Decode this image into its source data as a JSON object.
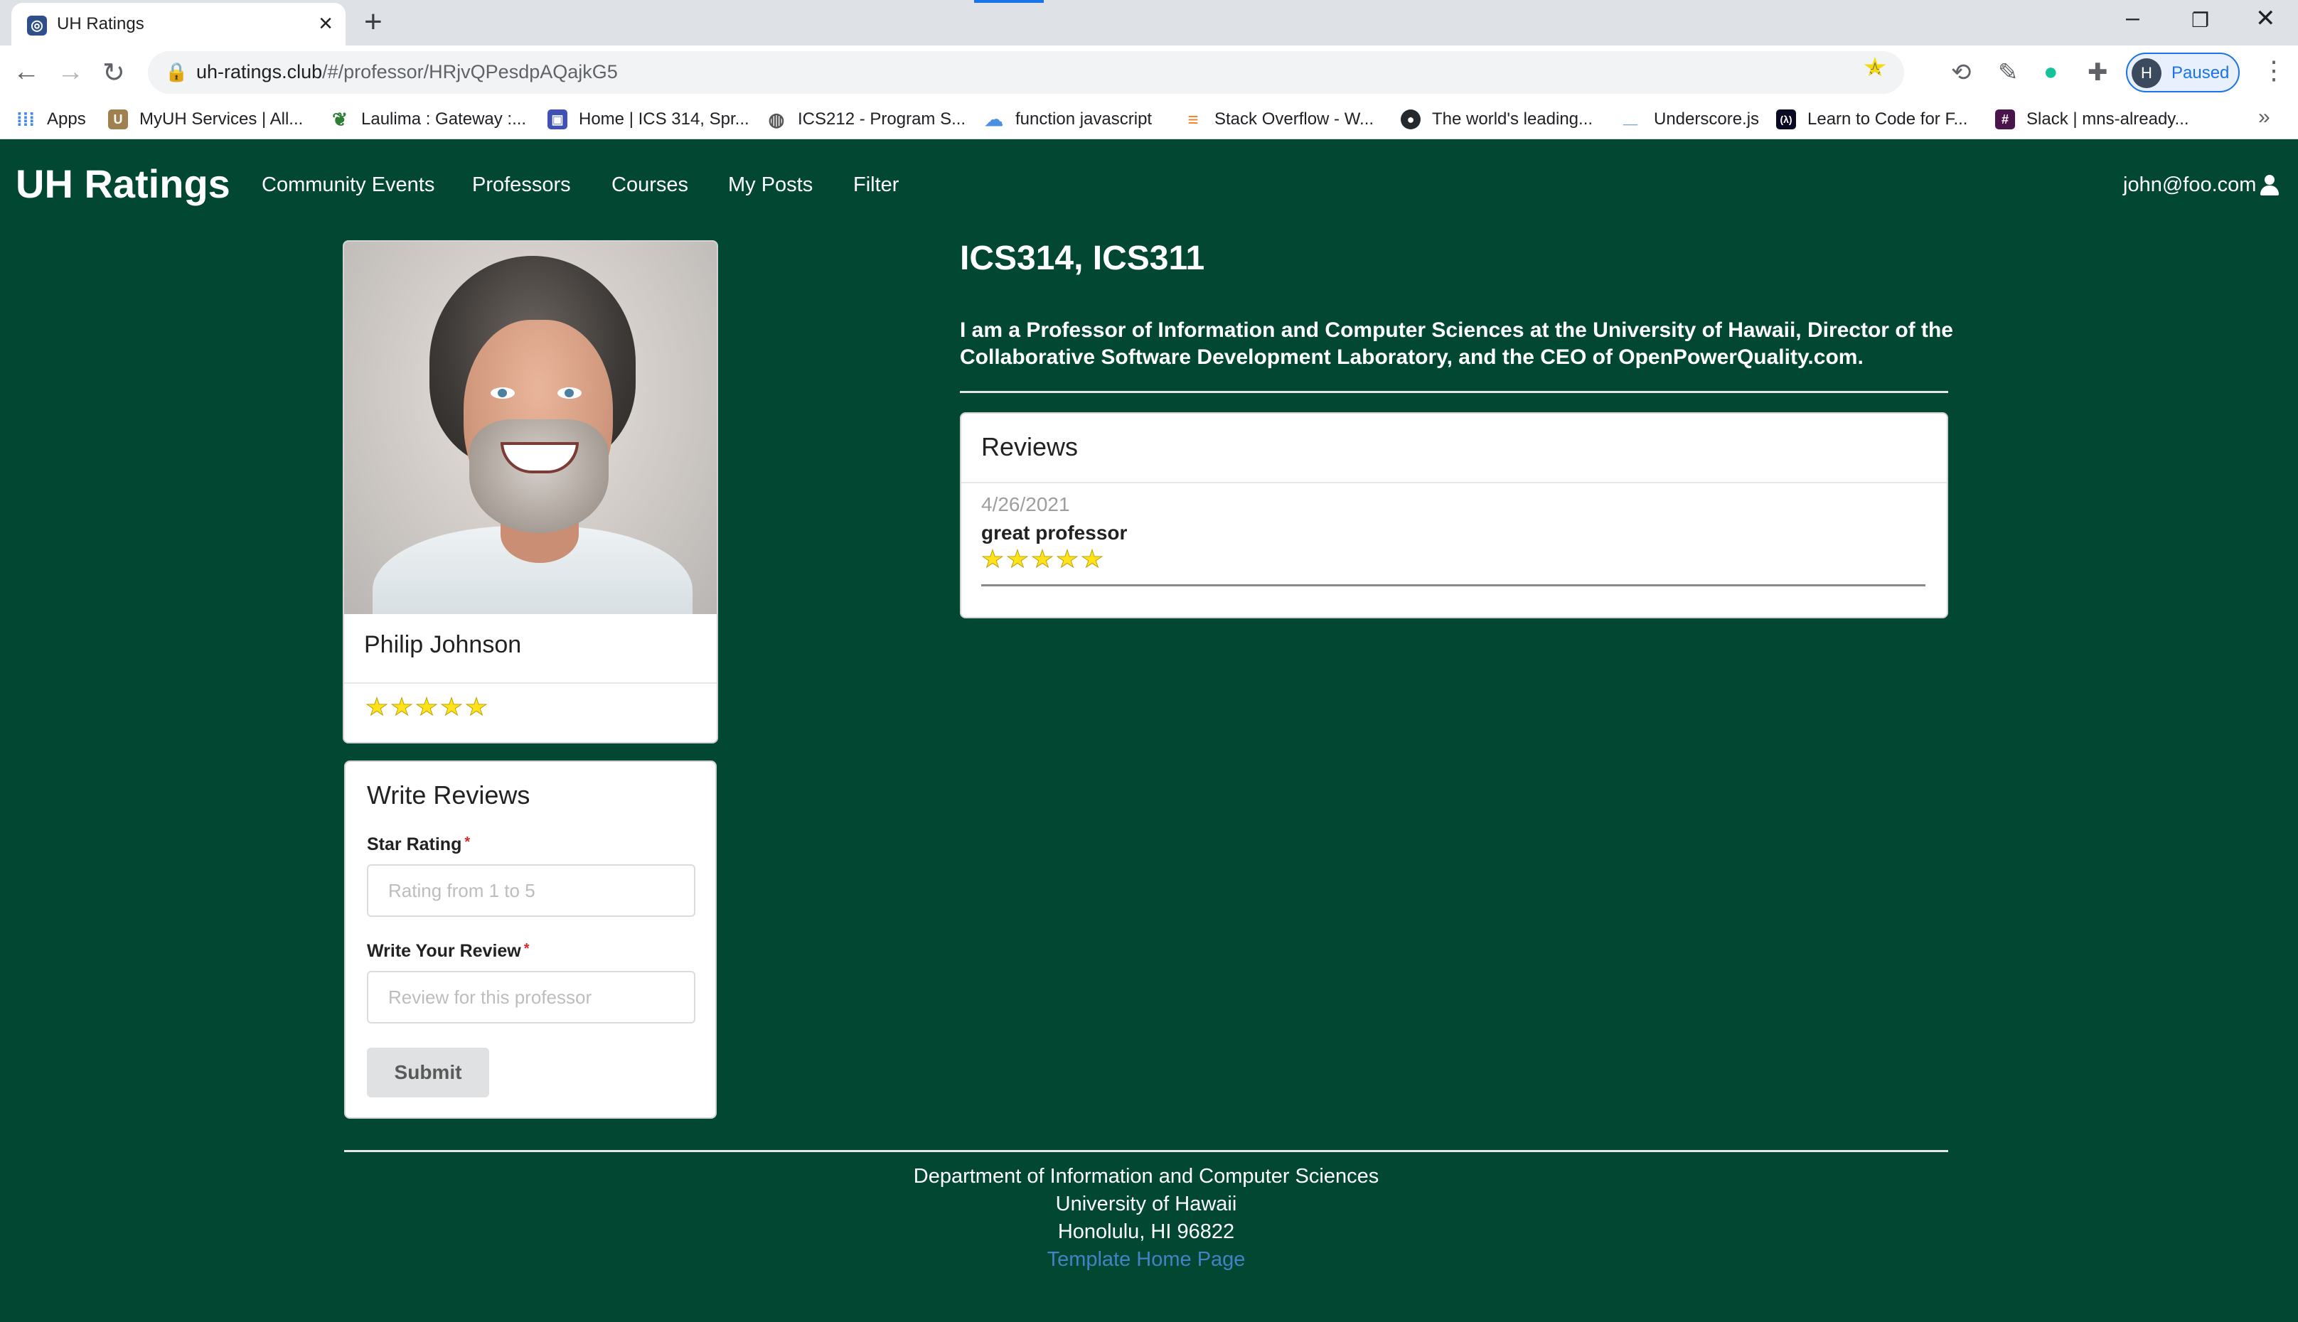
{
  "browser": {
    "tab_title": "UH Ratings",
    "url_host": "uh-ratings.club",
    "url_path": "/#/professor/HRjvQPesdpAQajkG5",
    "profile_initial": "H",
    "profile_status": "Paused",
    "bookmarks": [
      {
        "label": "Apps",
        "icon": "apps-grid-icon",
        "color": "#4285f4"
      },
      {
        "label": "MyUH Services | All...",
        "icon": "uh-icon",
        "color": "#a08050"
      },
      {
        "label": "Laulima : Gateway :...",
        "icon": "leaf-icon",
        "color": "#2e7d32"
      },
      {
        "label": "Home | ICS 314, Spr...",
        "icon": "page-icon",
        "color": "#3f51b5"
      },
      {
        "label": "ICS212 - Program S...",
        "icon": "globe-icon",
        "color": "#555555"
      },
      {
        "label": "function javascript",
        "icon": "cloud-icon",
        "color": "#4a90e2"
      },
      {
        "label": "Stack Overflow - W...",
        "icon": "stackoverflow-icon",
        "color": "#f48024"
      },
      {
        "label": "The world's leading...",
        "icon": "github-icon",
        "color": "#24292e"
      },
      {
        "label": "Underscore.js",
        "icon": "underscore-icon",
        "color": "#0b5ec0"
      },
      {
        "label": "Learn to Code for F...",
        "icon": "freecodecamp-icon",
        "color": "#0a0a23"
      },
      {
        "label": "Slack | mns-already...",
        "icon": "slack-icon",
        "color": "#4a154b"
      }
    ]
  },
  "navbar": {
    "brand": "UH Ratings",
    "links": [
      "Community Events",
      "Professors",
      "Courses",
      "My Posts",
      "Filter"
    ],
    "user": "john@foo.com"
  },
  "professor": {
    "name": "Philip Johnson",
    "rating": 5,
    "courses": "ICS314, ICS311",
    "description": "I am a Professor of Information and Computer Sciences at the University of Hawaii, Director of the Collaborative Software Development Laboratory, and the CEO of OpenPowerQuality.com."
  },
  "review_form": {
    "title": "Write Reviews",
    "star_label": "Star Rating",
    "star_placeholder": "Rating from 1 to 5",
    "review_label": "Write Your Review",
    "review_placeholder": "Review for this professor",
    "required_mark": "*",
    "submit_label": "Submit"
  },
  "reviews": {
    "title": "Reviews",
    "items": [
      {
        "date": "4/26/2021",
        "text": "great professor",
        "rating": 5
      }
    ]
  },
  "footer": {
    "line1": "Department of Information and Computer Sciences",
    "line2": "University of Hawaii",
    "line3": "Honolulu, HI 96822",
    "link": "Template Home Page"
  },
  "colors": {
    "page_background": "#024731",
    "star": "#ffe21a",
    "link": "#4183c4"
  }
}
